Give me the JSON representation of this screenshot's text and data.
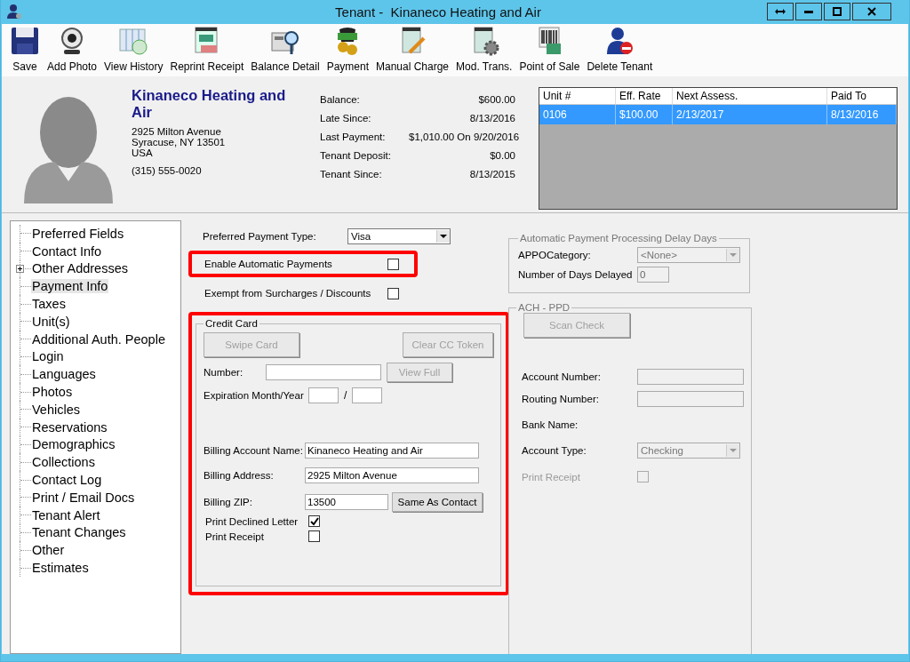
{
  "window": {
    "title": "Tenant -  Kinaneco Heating and Air"
  },
  "toolbar": [
    {
      "label": "Save"
    },
    {
      "label": "Add Photo"
    },
    {
      "label": "View History"
    },
    {
      "label": "Reprint Receipt"
    },
    {
      "label": "Balance Detail"
    },
    {
      "label": "Payment"
    },
    {
      "label": "Manual Charge"
    },
    {
      "label": "Mod. Trans."
    },
    {
      "label": "Point of Sale"
    },
    {
      "label": "Delete Tenant"
    }
  ],
  "tenant": {
    "name": "Kinaneco Heating and Air",
    "address": [
      "2925 Milton Avenue",
      "Syracuse, NY 13501",
      "USA"
    ],
    "phone": "(315) 555-0020"
  },
  "summary": [
    {
      "label": "Balance:",
      "value": "$600.00"
    },
    {
      "label": "Late Since:",
      "value": "8/13/2016"
    },
    {
      "label": "Last Payment:",
      "value": "$1,010.00 On 9/20/2016"
    },
    {
      "label": "Tenant Deposit:",
      "value": "$0.00"
    },
    {
      "label": "Tenant Since:",
      "value": "8/13/2015"
    }
  ],
  "units_table": {
    "columns": [
      "Unit #",
      "Eff. Rate",
      "Next Assess.",
      "Paid To"
    ],
    "rows": [
      {
        "cells": [
          "0106",
          "$100.00",
          "2/13/2017",
          "8/13/2016"
        ],
        "selected": true
      }
    ]
  },
  "sidebar": {
    "items": [
      {
        "label": "Preferred Fields",
        "selected": false
      },
      {
        "label": "Contact Info",
        "selected": false
      },
      {
        "label": "Other Addresses",
        "selected": false,
        "expanded": false
      },
      {
        "label": "Payment Info",
        "selected": true
      },
      {
        "label": "Taxes",
        "selected": false
      },
      {
        "label": "Unit(s)",
        "selected": false
      },
      {
        "label": "Additional Auth. People",
        "selected": false
      },
      {
        "label": "Login",
        "selected": false
      },
      {
        "label": "Languages",
        "selected": false
      },
      {
        "label": "Photos",
        "selected": false
      },
      {
        "label": "Vehicles",
        "selected": false
      },
      {
        "label": "Reservations",
        "selected": false
      },
      {
        "label": "Demographics",
        "selected": false
      },
      {
        "label": "Collections",
        "selected": false
      },
      {
        "label": "Contact Log",
        "selected": false
      },
      {
        "label": "Print / Email Docs",
        "selected": false
      },
      {
        "label": "Tenant Alert",
        "selected": false
      },
      {
        "label": "Tenant Changes",
        "selected": false
      },
      {
        "label": "Other",
        "selected": false
      },
      {
        "label": "Estimates",
        "selected": false
      }
    ]
  },
  "payment": {
    "preferred_payment_type": {
      "label": "Preferred Payment Type:",
      "value": "Visa"
    },
    "options": [
      {
        "label": "Enable Automatic Payments",
        "checked": false,
        "highlighted": true
      },
      {
        "label": "Exempt from Surcharges / Discounts",
        "checked": false,
        "highlighted": false
      }
    ],
    "credit_card": {
      "title": "Credit Card",
      "highlighted": true,
      "swipe_button": {
        "label": "Swipe Card",
        "disabled": true
      },
      "clear_token_button": {
        "label": "Clear CC Token",
        "disabled": true
      },
      "number": {
        "label": "Number:"
      },
      "view_full_button": {
        "label": "View Full",
        "disabled": true
      },
      "expiration": {
        "label": "Expiration Month/Year",
        "separator": "/"
      },
      "billing_fields": [
        {
          "label": "Billing Account Name:",
          "value": "Kinaneco Heating and Air"
        },
        {
          "label": "Billing Address:",
          "value": "2925 Milton Avenue"
        },
        {
          "label": "Billing ZIP:",
          "value": "13500"
        }
      ],
      "same_as_contact_button": {
        "label": "Same As Contact",
        "disabled": false
      },
      "checkboxes": [
        {
          "label": "Print Declined Letter",
          "checked": true
        },
        {
          "label": "Print Receipt",
          "checked": false
        }
      ]
    },
    "auto_delay": {
      "title": "Automatic Payment Processing Delay Days",
      "category": {
        "label": "APPOCategory:",
        "value": "<None>",
        "disabled": true
      },
      "days": {
        "label": "Number of Days Delayed",
        "value": "0",
        "disabled": true
      }
    },
    "ach": {
      "title": "ACH - PPD",
      "scan_button": {
        "label": "Scan Check",
        "disabled": true
      },
      "fields": [
        {
          "label": "Account Number:",
          "disabled": true
        },
        {
          "label": "Routing Number:",
          "disabled": true
        }
      ],
      "bank_name": {
        "label": "Bank Name:"
      },
      "account_type": {
        "label": "Account Type:",
        "value": "Checking",
        "disabled": true
      },
      "print_receipt": {
        "label": "Print Receipt",
        "checked": false,
        "disabled": true
      }
    }
  }
}
